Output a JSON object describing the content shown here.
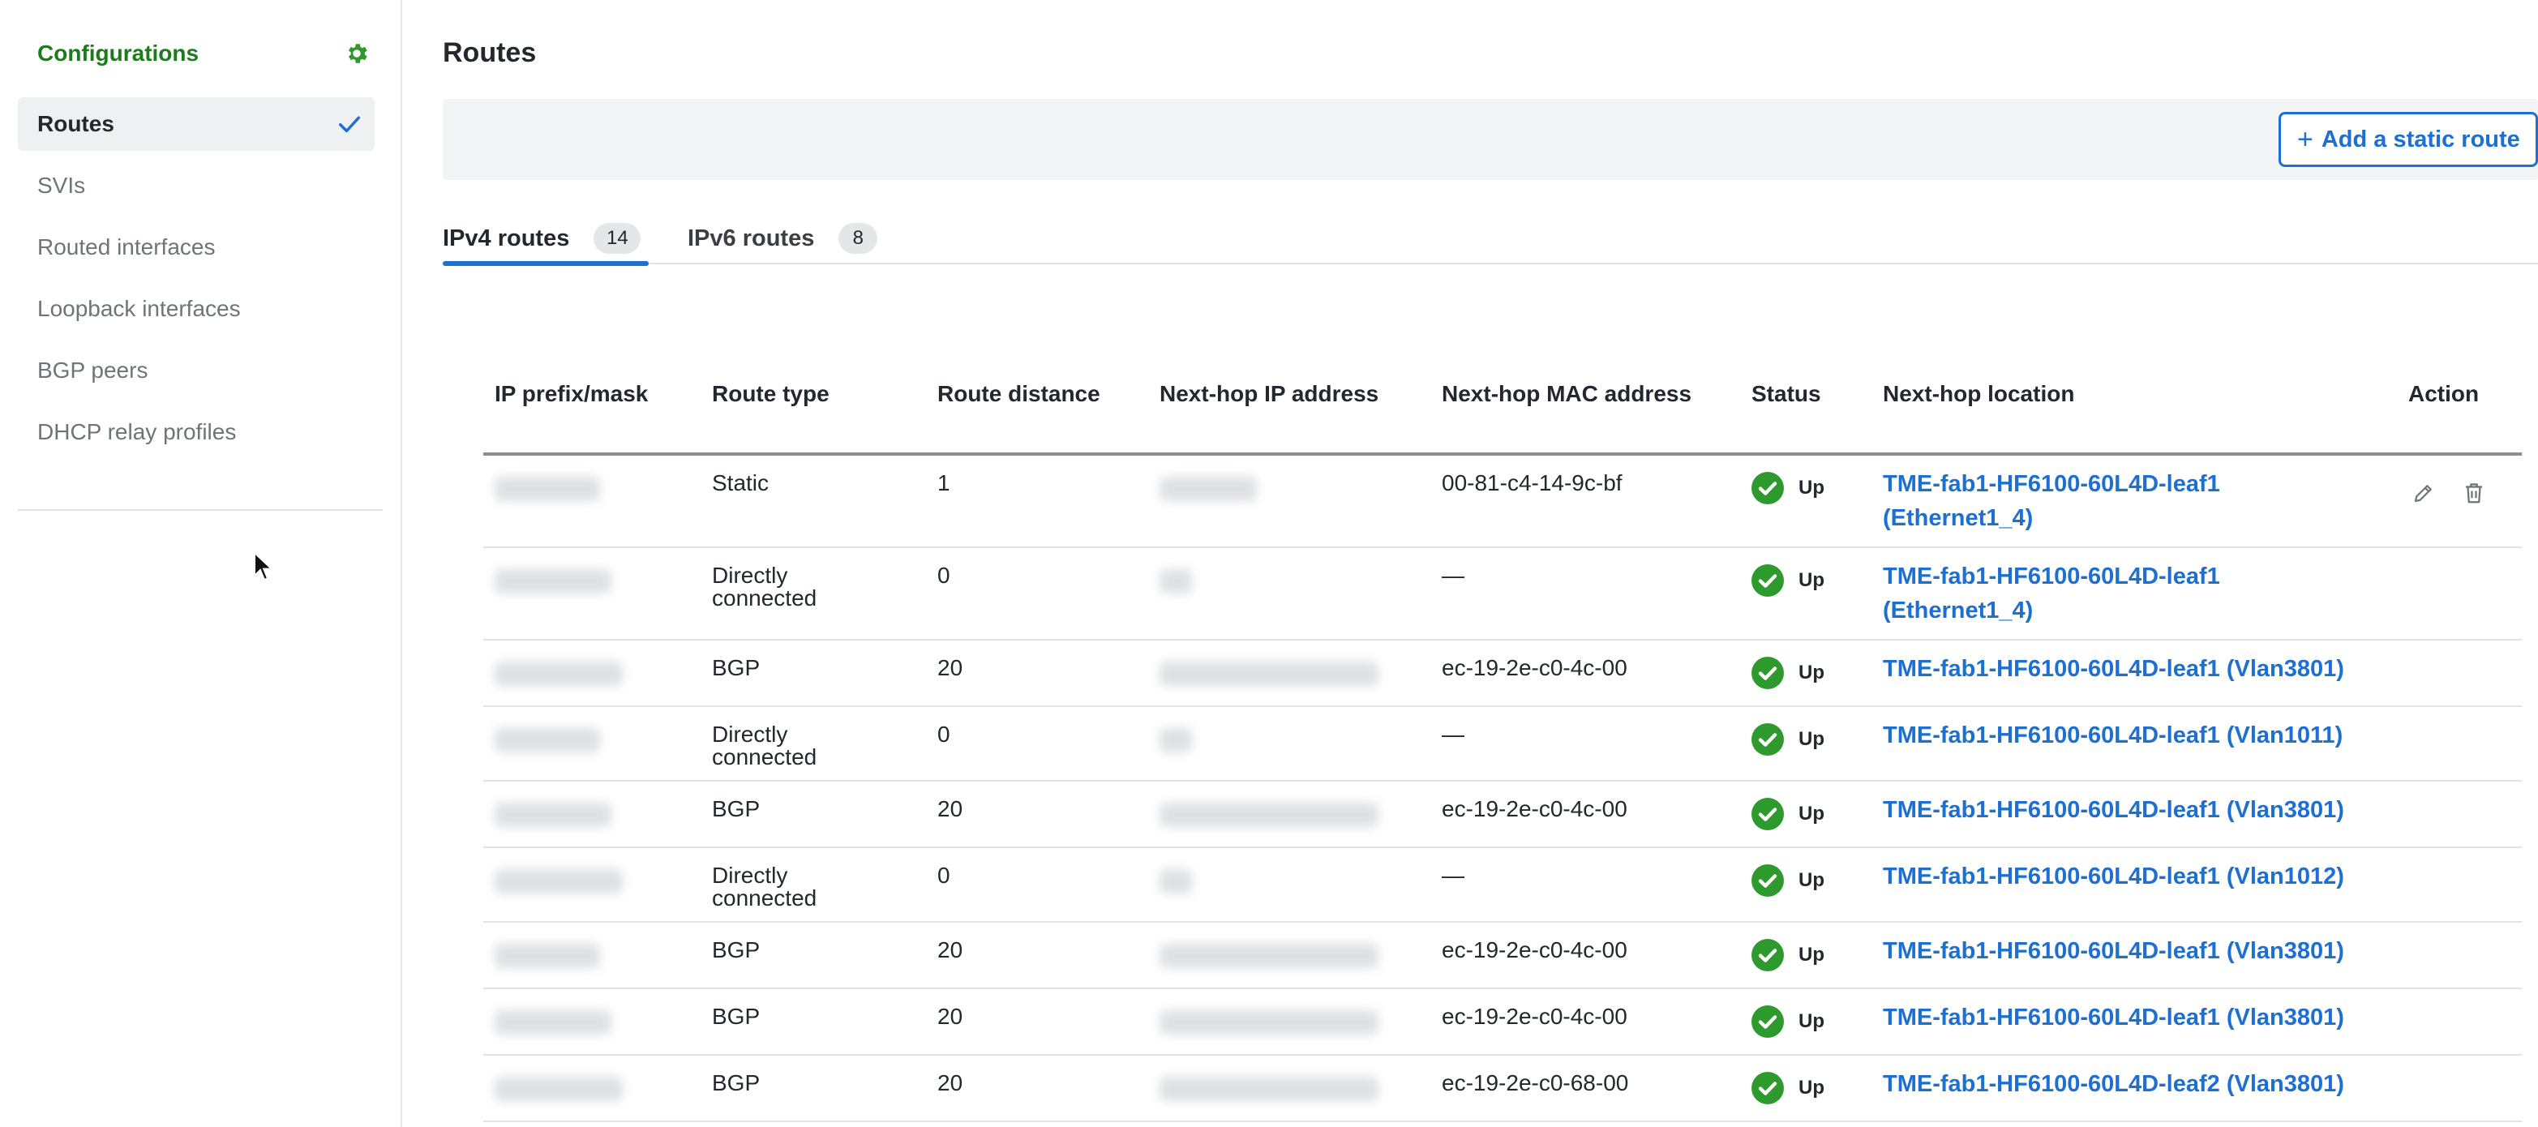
{
  "sidebar": {
    "title": "Configurations",
    "settings_icon": "gear-icon",
    "items": [
      {
        "label": "Routes",
        "active": true
      },
      {
        "label": "SVIs"
      },
      {
        "label": "Routed interfaces"
      },
      {
        "label": "Loopback interfaces"
      },
      {
        "label": "BGP peers"
      },
      {
        "label": "DHCP relay profiles"
      }
    ]
  },
  "main": {
    "title": "Routes",
    "add_button": {
      "icon": "plus",
      "label": "Add a static route"
    },
    "tabs": [
      {
        "label": "IPv4 routes",
        "count": "14",
        "active": true
      },
      {
        "label": "IPv6 routes",
        "count": "8"
      }
    ]
  },
  "table": {
    "columns": [
      "IP prefix/mask",
      "Route type",
      "Route distance",
      "Next-hop IP address",
      "Next-hop MAC address",
      "Status",
      "Next-hop location",
      "Action"
    ],
    "rows": [
      {
        "ip_prefix": "(redacted)",
        "route_type": "Static",
        "distance": "1",
        "next_hop_ip": "(redacted)",
        "mac": "00-81-c4-14-9c-bf",
        "status": "Up",
        "location": "TME-fab1-HF6100-60L4D-leaf1 (Ethernet1_4)",
        "actions": [
          "edit-icon",
          "delete-icon"
        ]
      },
      {
        "ip_prefix": "(redacted)",
        "route_type": "Directly connected",
        "distance": "0",
        "next_hop_ip": "(redacted)",
        "mac": "—",
        "status": "Up",
        "location": "TME-fab1-HF6100-60L4D-leaf1 (Ethernet1_4)"
      },
      {
        "ip_prefix": "(redacted)",
        "route_type": "BGP",
        "distance": "20",
        "next_hop_ip": "(redacted)",
        "mac": "ec-19-2e-c0-4c-00",
        "status": "Up",
        "location": "TME-fab1-HF6100-60L4D-leaf1 (Vlan3801)"
      },
      {
        "ip_prefix": "(redacted)",
        "route_type": "Directly connected",
        "distance": "0",
        "next_hop_ip": "(redacted)",
        "mac": "—",
        "status": "Up",
        "location": "TME-fab1-HF6100-60L4D-leaf1 (Vlan1011)"
      },
      {
        "ip_prefix": "(redacted)",
        "route_type": "BGP",
        "distance": "20",
        "next_hop_ip": "(redacted)",
        "mac": "ec-19-2e-c0-4c-00",
        "status": "Up",
        "location": "TME-fab1-HF6100-60L4D-leaf1 (Vlan3801)"
      },
      {
        "ip_prefix": "(redacted)",
        "route_type": "Directly connected",
        "distance": "0",
        "next_hop_ip": "(redacted)",
        "mac": "—",
        "status": "Up",
        "location": "TME-fab1-HF6100-60L4D-leaf1 (Vlan1012)"
      },
      {
        "ip_prefix": "(redacted)",
        "route_type": "BGP",
        "distance": "20",
        "next_hop_ip": "(redacted)",
        "mac": "ec-19-2e-c0-4c-00",
        "status": "Up",
        "location": "TME-fab1-HF6100-60L4D-leaf1 (Vlan3801)"
      },
      {
        "ip_prefix": "(redacted)",
        "route_type": "BGP",
        "distance": "20",
        "next_hop_ip": "(redacted)",
        "mac": "ec-19-2e-c0-4c-00",
        "status": "Up",
        "location": "TME-fab1-HF6100-60L4D-leaf1 (Vlan3801)"
      },
      {
        "ip_prefix": "(redacted)",
        "route_type": "BGP",
        "distance": "20",
        "next_hop_ip": "(redacted)",
        "mac": "ec-19-2e-c0-68-00",
        "status": "Up",
        "location": "TME-fab1-HF6100-60L4D-leaf2 (Vlan3801)"
      }
    ]
  },
  "colors": {
    "accent": "#1d6fd1",
    "brand_green": "#1d7a1d",
    "status_up": "#2e9a2e"
  }
}
